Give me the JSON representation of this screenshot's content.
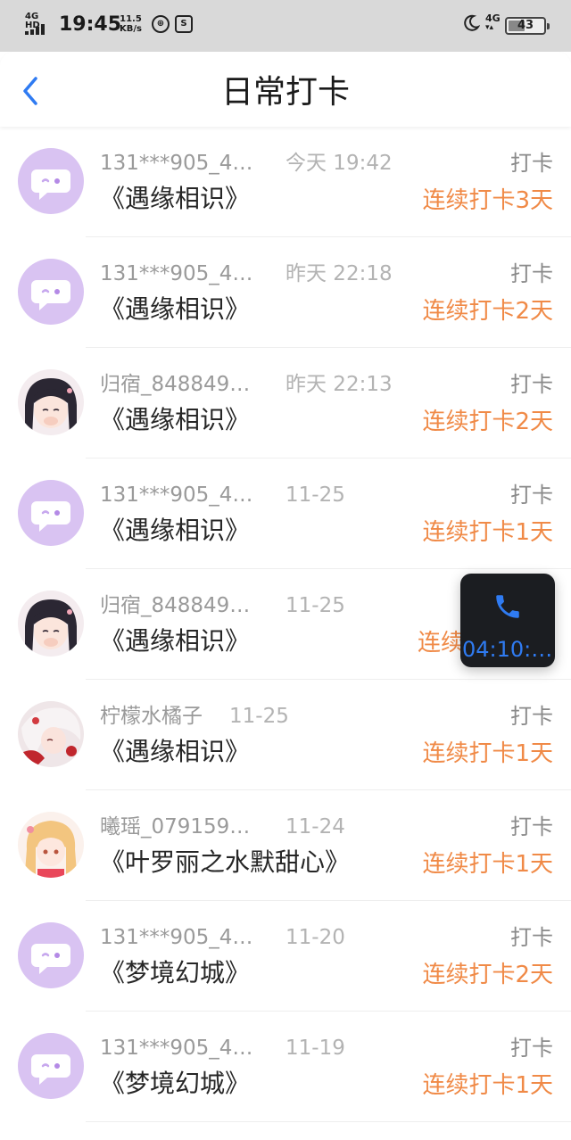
{
  "status_bar": {
    "network": "4G HD",
    "time": "19:45",
    "speed_value": "11.5",
    "speed_unit": "KB/s",
    "right_network": "4G",
    "battery": "43"
  },
  "header": {
    "title": "日常打卡"
  },
  "entries": [
    {
      "user": "131***905_4…",
      "time": "今天 19:42",
      "action": "打卡",
      "book": "《遇缘相识》",
      "streak": "连续打卡3天",
      "avatar": "chat-bubble"
    },
    {
      "user": "131***905_4…",
      "time": "昨天 22:18",
      "action": "打卡",
      "book": "《遇缘相识》",
      "streak": "连续打卡2天",
      "avatar": "chat-bubble"
    },
    {
      "user": "归宿_848849…",
      "time": "昨天 22:13",
      "action": "打卡",
      "book": "《遇缘相识》",
      "streak": "连续打卡2天",
      "avatar": "anime-girl-dark-hair"
    },
    {
      "user": "131***905_4…",
      "time": "11-25",
      "action": "打卡",
      "book": "《遇缘相识》",
      "streak": "连续打卡1天",
      "avatar": "chat-bubble"
    },
    {
      "user": "归宿_848849…",
      "time": "11-25",
      "action": "打卡",
      "book": "《遇缘相识》",
      "streak": "连续",
      "avatar": "anime-girl-dark-hair"
    },
    {
      "user": "柠檬水橘子",
      "time": "11-25",
      "action": "打卡",
      "book": "《遇缘相识》",
      "streak": "连续打卡1天",
      "avatar": "anime-girl-white-hair"
    },
    {
      "user": "曦瑶_079159…",
      "time": "11-24",
      "action": "打卡",
      "book": "《叶罗丽之水默甜心》",
      "streak": "连续打卡1天",
      "avatar": "anime-girl-blonde"
    },
    {
      "user": "131***905_4…",
      "time": "11-20",
      "action": "打卡",
      "book": "《梦境幻城》",
      "streak": "连续打卡2天",
      "avatar": "chat-bubble"
    },
    {
      "user": "131***905_4…",
      "time": "11-19",
      "action": "打卡",
      "book": "《梦境幻城》",
      "streak": "连续打卡1天",
      "avatar": "chat-bubble"
    }
  ],
  "call_widget": {
    "duration": "04:10:…",
    "icon": "phone-icon"
  },
  "colors": {
    "accent_blue": "#2f7bf2",
    "streak_orange": "#f08a47",
    "avatar_lavender": "#d9c3f2"
  }
}
